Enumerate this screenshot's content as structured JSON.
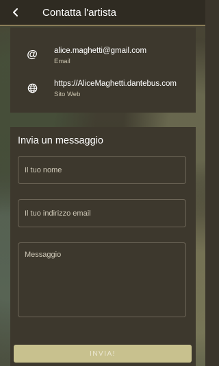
{
  "header": {
    "title": "Contatta l'artista",
    "back_icon": "chevron-left-icon"
  },
  "contacts": [
    {
      "icon": "at-icon",
      "value": "alice.maghetti@gmail.com",
      "label": "Email"
    },
    {
      "icon": "globe-icon",
      "value": "https://AliceMaghetti.dantebus.com",
      "label": "Sito Web"
    }
  ],
  "form": {
    "title": "Invia un messaggio",
    "name_placeholder": "Il tuo nome",
    "email_placeholder": "Il tuo indirizzo email",
    "message_placeholder": "Messaggio",
    "submit_label": "INVIA!"
  },
  "colors": {
    "header_bg": "#2f2b22",
    "accent": "#8a7d58",
    "panel_bg": "#3d382d",
    "button_bg": "#c8c18e"
  }
}
